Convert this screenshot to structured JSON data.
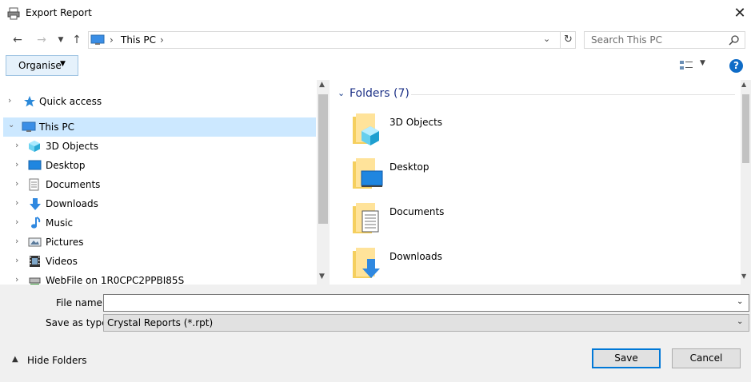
{
  "window": {
    "title": "Export Report"
  },
  "address": {
    "crumbs": [
      "This PC"
    ]
  },
  "search": {
    "placeholder": "Search This PC"
  },
  "toolbar": {
    "organise_label": "Organise"
  },
  "nav": {
    "items": [
      {
        "label": "Quick access",
        "icon": "quick-access-star-icon"
      },
      {
        "label": "This PC",
        "icon": "computer-icon",
        "selected": true
      },
      {
        "label": "3D Objects",
        "icon": "3d-objects-icon"
      },
      {
        "label": "Desktop",
        "icon": "desktop-icon"
      },
      {
        "label": "Documents",
        "icon": "documents-icon"
      },
      {
        "label": "Downloads",
        "icon": "downloads-icon"
      },
      {
        "label": "Music",
        "icon": "music-icon"
      },
      {
        "label": "Pictures",
        "icon": "pictures-icon"
      },
      {
        "label": "Videos",
        "icon": "videos-icon"
      },
      {
        "label": "WebFile on 1R0CPC2PPBI85S",
        "icon": "network-drive-icon"
      }
    ]
  },
  "content": {
    "group_title": "Folders (7)",
    "folders": [
      {
        "name": "3D Objects",
        "overlay": "3d-cube"
      },
      {
        "name": "Desktop",
        "overlay": "monitor"
      },
      {
        "name": "Documents",
        "overlay": "document"
      },
      {
        "name": "Downloads",
        "overlay": "down-arrow"
      }
    ]
  },
  "bottom": {
    "filename_label": "File name:",
    "filename_value": "",
    "savetype_label": "Save as type:",
    "savetype_value": "Crystal Reports (*.rpt)",
    "hide_folders_label": "Hide Folders",
    "save_label": "Save",
    "cancel_label": "Cancel"
  },
  "colors": {
    "accent": "#0078d7",
    "selection": "#cce8ff",
    "group_title": "#1e3287"
  }
}
